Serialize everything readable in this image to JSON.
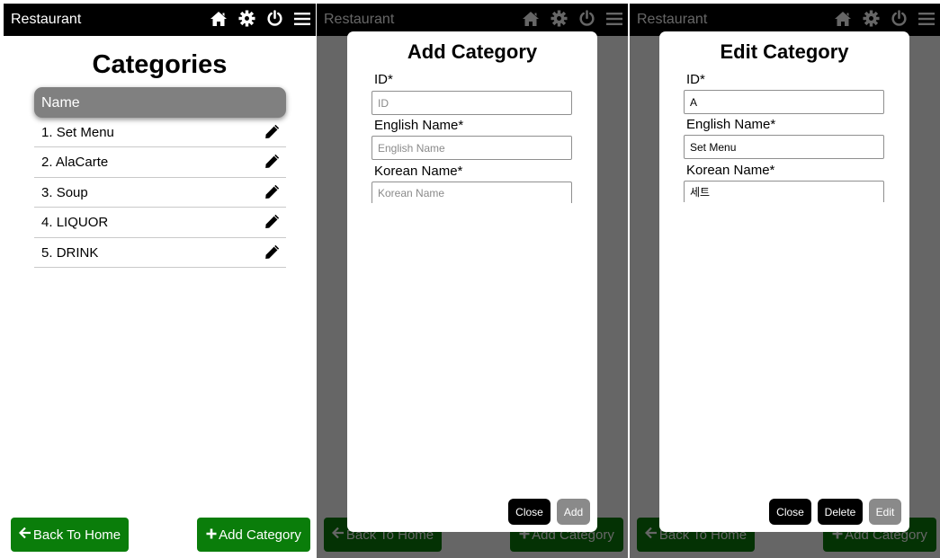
{
  "app": {
    "title": "Restaurant"
  },
  "topbar_icons": [
    "home-icon",
    "gear-icon",
    "power-icon",
    "menu-icon"
  ],
  "categories": {
    "title": "Categories",
    "column_header": "Name",
    "items": [
      {
        "num": "1",
        "name": "Set Menu"
      },
      {
        "num": "2",
        "name": "AlaCarte"
      },
      {
        "num": "3",
        "name": "Soup"
      },
      {
        "num": "4",
        "name": "LIQUOR"
      },
      {
        "num": "5",
        "name": "DRINK"
      }
    ]
  },
  "footer": {
    "back_label": "Back To Home",
    "add_label": "Add Category"
  },
  "add_modal": {
    "title": "Add Category",
    "id_label": "ID*",
    "id_placeholder": "ID",
    "english_label": "English Name*",
    "english_placeholder": "English Name",
    "korean_label": "Korean Name*",
    "korean_placeholder": "Korean Name",
    "close_label": "Close",
    "add_label": "Add"
  },
  "edit_modal": {
    "title": "Edit Category",
    "id_label": "ID*",
    "id_value": "A",
    "english_label": "English Name*",
    "english_value": "Set Menu",
    "korean_label": "Korean Name*",
    "korean_value": "세트",
    "close_label": "Close",
    "delete_label": "Delete",
    "edit_label": "Edit"
  },
  "colors": {
    "topbar": "#000000",
    "accent_green": "#0a7d0a",
    "header_grey": "#808080",
    "disabled_grey": "#8a8a8a"
  }
}
